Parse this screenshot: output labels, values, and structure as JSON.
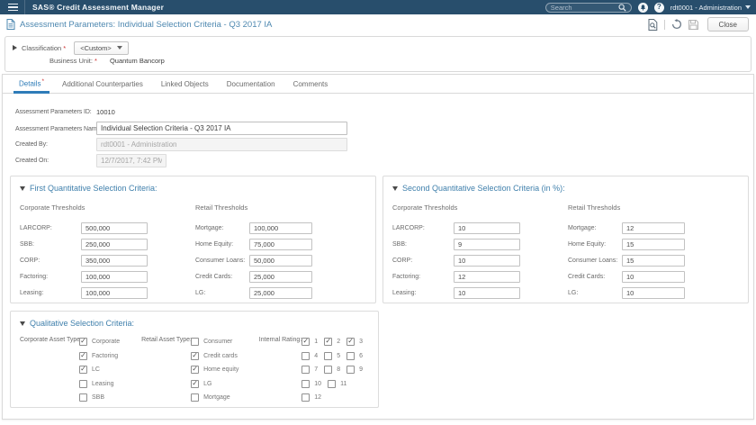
{
  "app_bar": {
    "title": "SAS® Credit Assessment Manager",
    "search_placeholder": "Search",
    "user": "rdt0001 - Administration"
  },
  "toolbar": {
    "title": "Assessment Parameters: Individual Selection Criteria - Q3 2017 IA",
    "close_label": "Close"
  },
  "misc": {
    "required_mark": "*"
  },
  "classification": {
    "label": "Classification",
    "value": "<Custom>",
    "business_unit_label": "Business Unit:",
    "business_unit_value": "Quantum Bancorp"
  },
  "tabs": [
    {
      "label": "Details",
      "mark": "*"
    },
    {
      "label": "Additional Counterparties",
      "mark": ""
    },
    {
      "label": "Linked Objects",
      "mark": ""
    },
    {
      "label": "Documentation",
      "mark": ""
    },
    {
      "label": "Comments",
      "mark": ""
    }
  ],
  "details": {
    "id_label": "Assessment Parameters ID:",
    "id_value": "10010",
    "name_label": "Assessment Parameters Name:",
    "name_value": "Individual Selection Criteria - Q3 2017 IA",
    "created_by_label": "Created By:",
    "created_by_value": "rdt0001 - Administration",
    "created_on_label": "Created On:",
    "created_on_value": "12/7/2017, 7:42 PM"
  },
  "first_quant": {
    "title": "First Quantitative Selection Criteria:",
    "corporate_header": "Corporate Thresholds",
    "retail_header": "Retail Thresholds",
    "corporate_rows": [
      {
        "label": "LARCORP:",
        "value": "500,000"
      },
      {
        "label": "SBB:",
        "value": "250,000"
      },
      {
        "label": "CORP:",
        "value": "350,000"
      },
      {
        "label": "Factoring:",
        "value": "100,000"
      },
      {
        "label": "Leasing:",
        "value": "100,000"
      }
    ],
    "retail_rows": [
      {
        "label": "Mortgage:",
        "value": "100,000"
      },
      {
        "label": "Home Equity:",
        "value": "75,000"
      },
      {
        "label": "Consumer Loans:",
        "value": "50,000"
      },
      {
        "label": "Credit Cards:",
        "value": "25,000"
      },
      {
        "label": "LG:",
        "value": "25,000"
      }
    ]
  },
  "second_quant": {
    "title": "Second Quantitative Selection Criteria (in %):",
    "corporate_header": "Corporate Thresholds",
    "retail_header": "Retail Thresholds",
    "corporate_rows": [
      {
        "label": "LARCORP:",
        "value": "10"
      },
      {
        "label": "SBB:",
        "value": "9"
      },
      {
        "label": "CORP:",
        "value": "10"
      },
      {
        "label": "Factoring:",
        "value": "12"
      },
      {
        "label": "Leasing:",
        "value": "10"
      }
    ],
    "retail_rows": [
      {
        "label": "Mortgage:",
        "value": "12"
      },
      {
        "label": "Home Equity:",
        "value": "15"
      },
      {
        "label": "Consumer Loans:",
        "value": "15"
      },
      {
        "label": "Credit Cards:",
        "value": "10"
      },
      {
        "label": "LG:",
        "value": "10"
      }
    ]
  },
  "qualitative": {
    "title": "Qualitative Selection Criteria:",
    "corporate_label": "Corporate Asset Type:",
    "retail_label": "Retail Asset Type:",
    "rating_label": "Internal Rating:",
    "corporate_items": [
      {
        "label": "Corporate",
        "checked": true
      },
      {
        "label": "Factoring",
        "checked": true
      },
      {
        "label": "LC",
        "checked": true
      },
      {
        "label": "Leasing",
        "checked": false
      },
      {
        "label": "SBB",
        "checked": false
      }
    ],
    "retail_items": [
      {
        "label": "Consumer",
        "checked": false
      },
      {
        "label": "Credit cards",
        "checked": true
      },
      {
        "label": "Home equity",
        "checked": true
      },
      {
        "label": "LG",
        "checked": true
      },
      {
        "label": "Mortgage",
        "checked": false
      }
    ],
    "rating_rows": [
      [
        {
          "label": "1",
          "checked": true
        },
        {
          "label": "2",
          "checked": true
        },
        {
          "label": "3",
          "checked": true
        }
      ],
      [
        {
          "label": "4",
          "checked": false
        },
        {
          "label": "5",
          "checked": false
        },
        {
          "label": "6",
          "checked": false
        }
      ],
      [
        {
          "label": "7",
          "checked": false
        },
        {
          "label": "8",
          "checked": false
        },
        {
          "label": "9",
          "checked": false
        }
      ],
      [
        {
          "label": "10",
          "checked": false
        },
        {
          "label": "11",
          "checked": false
        }
      ],
      [
        {
          "label": "12",
          "checked": false
        }
      ]
    ]
  },
  "colors": {
    "app_bar_bg": "#284e6c",
    "accent_blue": "#2e7cb8",
    "header_blue": "#4080ac",
    "required_red": "#cc2e2e"
  }
}
